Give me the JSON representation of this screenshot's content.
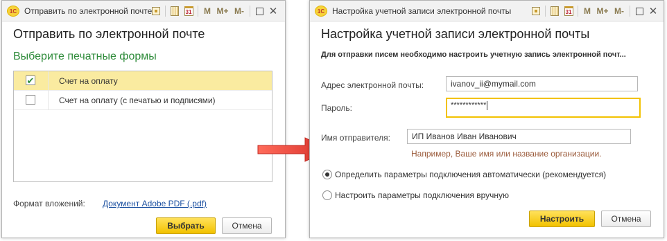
{
  "left_window": {
    "title": "Отправить по электронной почте",
    "heading": "Отправить по электронной почте",
    "subheading": "Выберите печатные формы",
    "print_forms": [
      {
        "label": "Счет на оплату",
        "checked": true
      },
      {
        "label": "Счет на оплату (с печатью и подписями)",
        "checked": false
      }
    ],
    "attachment_format_label": "Формат вложений:",
    "attachment_format_link": "Документ Adobe PDF (.pdf)",
    "select_button": "Выбрать",
    "cancel_button": "Отмена"
  },
  "right_window": {
    "title": "Настройка учетной записи электронной почты",
    "heading": "Настройка учетной записи электронной почты",
    "notice": "Для отправки писем необходимо настроить учетную запись электронной почт...",
    "email_label": "Адрес электронной почты:",
    "email_value": "ivanov_ii@mymail.com",
    "password_label": "Пароль:",
    "password_value": "************",
    "sender_label": "Имя отправителя:",
    "sender_value": "ИП Иванов  Иван Иванович",
    "sender_hint": "Например, Ваше имя или название организации.",
    "radio_auto": "Определить параметры подключения автоматически (рекомендуется)",
    "radio_manual": "Настроить параметры подключения вручную",
    "radio_auto_selected": true,
    "configure_button": "Настроить",
    "cancel_button": "Отмена"
  },
  "toolbar": {
    "app_logo": "1С",
    "calendar_day": "31",
    "m_label": "M",
    "m_plus_label": "M+",
    "m_minus_label": "M-"
  },
  "colors": {
    "accent_yellow": "#f2c200",
    "selected_row": "#faeba0",
    "subheading_green": "#2e8b3a",
    "link_blue": "#1a4fa0",
    "hint_brown": "#9a5a3a",
    "arrow_red": "#e0443a"
  },
  "icons": {
    "arrow": "right-arrow-icon",
    "home": "home-icon",
    "calculator": "calculator-icon",
    "calendar": "calendar-icon",
    "maximize": "maximize-icon",
    "close": "close-icon"
  }
}
